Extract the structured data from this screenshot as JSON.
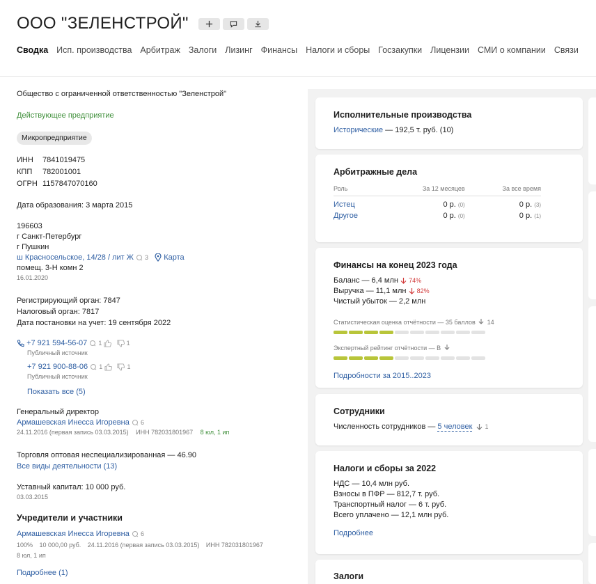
{
  "header": {
    "title": "ООО \"ЗЕЛЕНСТРОЙ\"",
    "buttons": [
      {
        "icon": "plus-icon"
      },
      {
        "icon": "comment-icon"
      },
      {
        "icon": "download-icon"
      }
    ],
    "tabs": [
      "Сводка",
      "Исп. производства",
      "Арбитраж",
      "Залоги",
      "Лизинг",
      "Финансы",
      "Налоги и сборы",
      "Госзакупки",
      "Лицензии",
      "СМИ о компании",
      "Связи"
    ]
  },
  "left": {
    "full_name": "Общество с ограниченной ответственностью \"Зеленстрой\"",
    "status": "Действующее предприятие",
    "badge": "Микропредприятие",
    "ids": [
      {
        "k": "ИНН",
        "v": "7841019475"
      },
      {
        "k": "КПП",
        "v": "782001001"
      },
      {
        "k": "ОГРН",
        "v": "1157847070160"
      }
    ],
    "founded": "Дата образования: 3 марта 2015",
    "address": {
      "zip": "196603",
      "city": "г Санкт-Петербург",
      "town": "г Пушкин",
      "street": "ш Красносельское, 14/28 / лит Ж",
      "street_count": "3",
      "map": "Карта",
      "room": "помещ. 3-Н комн 2",
      "date": "16.01.2020"
    },
    "reg": {
      "line1": "Регистрирующий орган: 7847",
      "line2": "Налоговый орган: 7817",
      "line3": "Дата постановки на учет: 19 сентября 2022"
    },
    "phones": [
      {
        "number": "+7 921 594-56-07",
        "comments": "1",
        "likes": "",
        "dislikes": "1",
        "source": "Публичный источник"
      },
      {
        "number": "+7 921 900-88-06",
        "comments": "1",
        "likes": "",
        "dislikes": "1",
        "source": "Публичный источник"
      }
    ],
    "show_all": "Показать все (5)",
    "director": {
      "label": "Генеральный директор",
      "name": "Армашевская Инесса Игоревна",
      "count": "6",
      "date": "24.11.2016 (первая запись 03.03.2015)",
      "inn": "ИНН 782031801967",
      "tenure": "8 юл, 1 ип"
    },
    "activity": {
      "main": "Торговля оптовая неспециализированная — 46.90",
      "all": "Все виды деятельности (13)"
    },
    "capital": {
      "text": "Уставный капитал: 10 000 руб.",
      "date": "03.03.2015"
    },
    "founders": {
      "title": "Учредители и участники",
      "name": "Армашевская Инесса Игоревна",
      "count": "6",
      "share": "100%",
      "amount": "10 000,00 руб.",
      "date": "24.11.2016 (первая запись 03.03.2015)",
      "inn": "ИНН 782031801967",
      "tenure": "8 юл, 1 ип",
      "more": "Подробнее (1)"
    }
  },
  "cards": {
    "enforcement": {
      "title": "Исполнительные производства",
      "link": "Исторические",
      "rest": " — 192,5 т. руб. (10)"
    },
    "arbitration": {
      "title": "Арбитражные дела",
      "headers": [
        "Роль",
        "За 12 месяцев",
        "За все время"
      ],
      "rows": [
        {
          "role": "Истец",
          "y12": "0 р.",
          "y12c": "(0)",
          "all": "0 р.",
          "allc": "(3)"
        },
        {
          "role": "Другое",
          "y12": "0 р.",
          "y12c": "(0)",
          "all": "0 р.",
          "allc": "(1)"
        }
      ]
    },
    "finance": {
      "title": "Финансы на конец 2023 года",
      "balance": "Баланс — 6,4 млн",
      "balance_change": "74%",
      "revenue": "Выручка — 11,1 млн",
      "revenue_change": "82%",
      "loss": "Чистый убыток — 2,2 млн",
      "stat_label": "Статистическая оценка отчётности — 35 баллов",
      "stat_change": "14",
      "stat_level": 0.35,
      "expert_label": "Экспертный рейтинг отчётности — B",
      "expert_level": 0.4,
      "more": "Подробности за 2015..2023"
    },
    "staff": {
      "title": "Сотрудники",
      "text": "Численность сотрудников — ",
      "count": "5 человек",
      "change": "1"
    },
    "taxes": {
      "title": "Налоги и сборы за 2022",
      "lines": [
        "НДС — 10,4 млн руб.",
        "Взносы в ПФР — 812,7 т. руб.",
        "Транспортный налог — 6 т. руб.",
        "Всего уплачено — 12,1 млн руб."
      ],
      "more": "Подробнее"
    },
    "pledges": {
      "title": "Залоги"
    }
  },
  "colors": {
    "link": "#2f5fa3",
    "status_green": "#3f8f3a",
    "decline_red": "#d23a3a",
    "rating_bar": "#b8c53a"
  }
}
